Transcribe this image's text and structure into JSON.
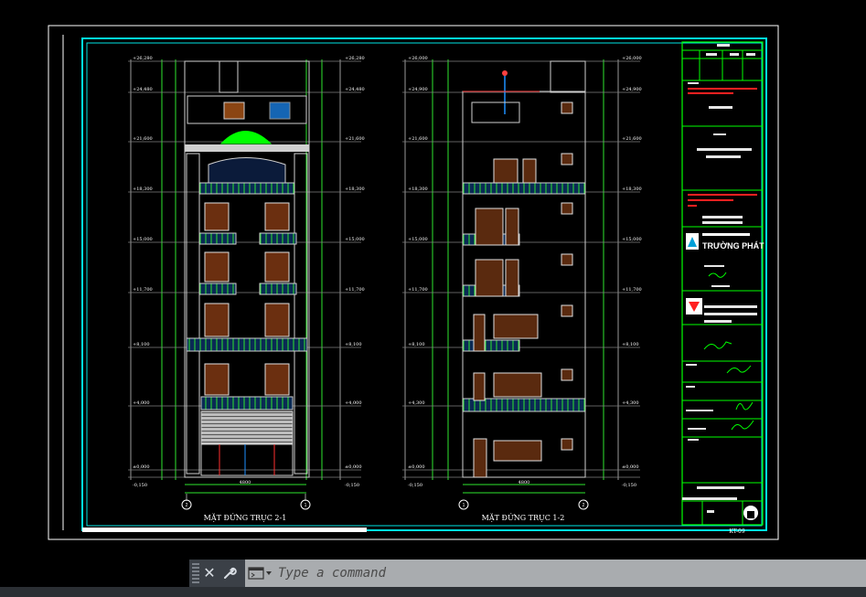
{
  "drawing": {
    "left_elevation_title": "MẶT ĐỨNG TRỤC 2-1",
    "right_elevation_title": "MẶT ĐỨNG TRỤC 1-2",
    "sheet_number": "KT-09",
    "company_name": "TRƯỜNG PHÁT",
    "left_levels": [
      "+26,280",
      "+24,480",
      "+21,600",
      "+18,300",
      "+15,000",
      "+11,700",
      "+8,100",
      "+4,000",
      "±0,000",
      "-0,150"
    ],
    "right_levels": [
      "+26,000",
      "+24,900",
      "+21,600",
      "+18,300",
      "+15,000",
      "+11,700",
      "+8,100",
      "+4,300",
      "±0,000",
      "-0,150"
    ],
    "grid_markers_left": [
      "2",
      "1"
    ],
    "grid_markers_right": [
      "1",
      "2"
    ],
    "dim_bottom": "4800"
  },
  "command_line": {
    "placeholder": "Type a command",
    "close_label": "✕",
    "customize_label": "🔧"
  },
  "colors": {
    "background": "#000000",
    "frame_white": "#ffffff",
    "frame_cyan": "#00e5e5",
    "title_green": "#00ff00",
    "dim_green": "#2ee62e",
    "line_gray": "#9a9a9a",
    "accent_red": "#ff2020"
  }
}
